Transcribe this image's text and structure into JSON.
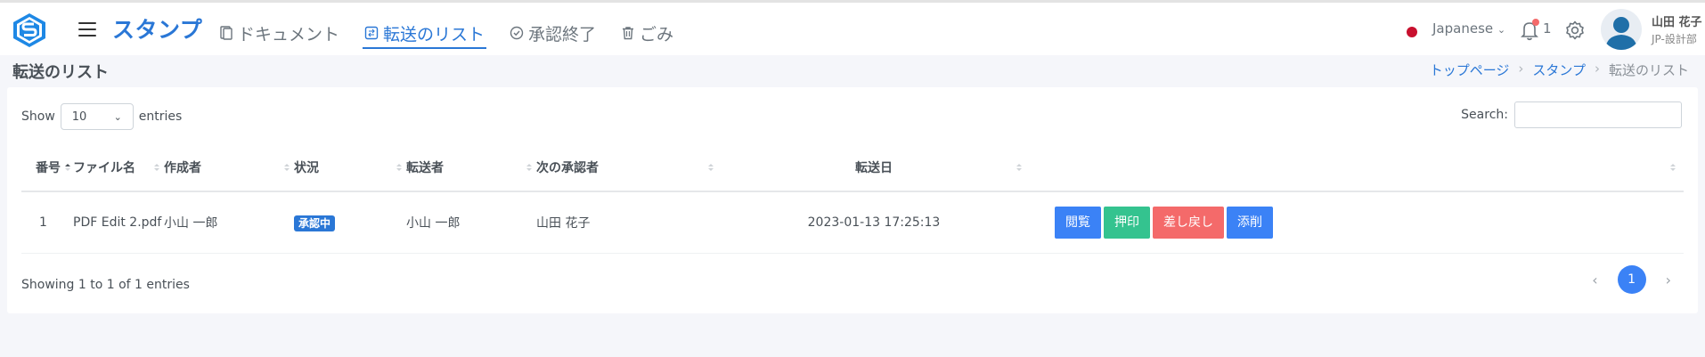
{
  "app": {
    "brand": "スタンプ",
    "nav": [
      {
        "label": "ドキュメント",
        "icon": "document-icon"
      },
      {
        "label": "転送のリスト",
        "icon": "transfer-list-icon",
        "active": true
      },
      {
        "label": "承認終了",
        "icon": "check-circle-icon"
      },
      {
        "label": "ごみ",
        "icon": "trash-icon"
      }
    ],
    "language": "Japanese",
    "notification_count": "1",
    "user": {
      "name": "山田 花子",
      "dept": "JP-設計部"
    }
  },
  "page": {
    "title": "転送のリスト",
    "breadcrumb": [
      "トップページ",
      "スタンプ",
      "転送のリスト"
    ]
  },
  "table_controls": {
    "show_label": "Show",
    "entries_label": "entries",
    "page_size": "10",
    "search_label": "Search:",
    "search_value": ""
  },
  "table": {
    "columns": [
      "番号",
      "ファイル名",
      "作成者",
      "状況",
      "転送者",
      "次の承認者",
      "転送日",
      ""
    ],
    "rows": [
      {
        "no": "1",
        "file": "PDF Edit 2.pdf",
        "creator": "小山 一郎",
        "status": "承認中",
        "sender": "小山 一郎",
        "next_approver": "山田 花子",
        "date": "2023-01-13 17:25:13",
        "actions": [
          "閲覧",
          "押印",
          "差し戻し",
          "添削"
        ]
      }
    ]
  },
  "footer": {
    "info": "Showing 1 to 1 of 1 entries",
    "pages": [
      "1"
    ],
    "current_page": "1"
  },
  "colors": {
    "brand": "#2a77d6",
    "primary_button": "#3b82f6",
    "success_button": "#34c38f",
    "danger_button": "#f46a6a"
  }
}
